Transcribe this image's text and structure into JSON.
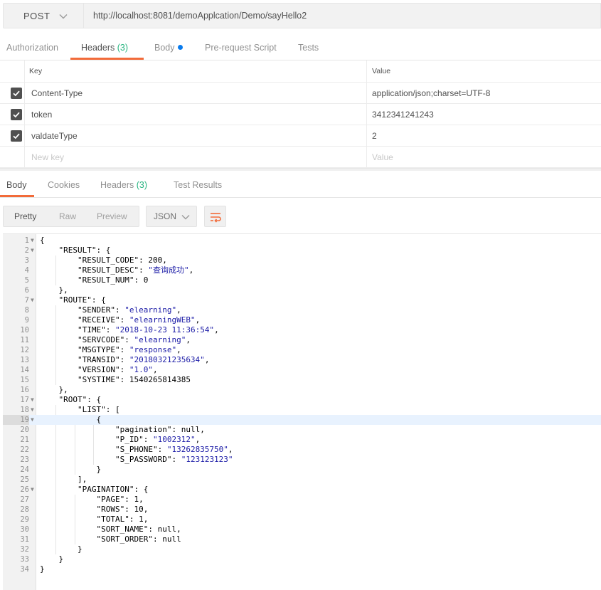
{
  "request": {
    "method": "POST",
    "url": "http://localhost:8081/demoApplcation/Demo/sayHello2"
  },
  "request_tabs": [
    {
      "label": "Authorization",
      "count": "",
      "dot": false,
      "active": false
    },
    {
      "label": "Headers",
      "count": "(3)",
      "dot": false,
      "active": true
    },
    {
      "label": "Body",
      "count": "",
      "dot": true,
      "active": false
    },
    {
      "label": "Pre-request Script",
      "count": "",
      "dot": false,
      "active": false
    },
    {
      "label": "Tests",
      "count": "",
      "dot": false,
      "active": false
    }
  ],
  "headers_table": {
    "key_header": "Key",
    "value_header": "Value",
    "rows": [
      {
        "key": "Content-Type",
        "value": "application/json;charset=UTF-8",
        "checked": true
      },
      {
        "key": "token",
        "value": "3412341241243",
        "checked": true
      },
      {
        "key": "valdateType",
        "value": "2",
        "checked": true
      }
    ],
    "new_key_placeholder": "New key",
    "new_value_placeholder": "Value"
  },
  "response_tabs": [
    {
      "label": "Body",
      "count": "",
      "active": true
    },
    {
      "label": "Cookies",
      "count": "",
      "active": false
    },
    {
      "label": "Headers",
      "count": "(3)",
      "active": false
    },
    {
      "label": "Test Results",
      "count": "",
      "active": false
    }
  ],
  "view_modes": {
    "pretty": "Pretty",
    "raw": "Raw",
    "preview": "Preview"
  },
  "format": "JSON",
  "code_lines": [
    "{",
    "    \"RESULT\": {",
    "        \"RESULT_CODE\": 200,",
    "        \"RESULT_DESC\": \"查询成功\",",
    "        \"RESULT_NUM\": 0",
    "    },",
    "    \"ROUTE\": {",
    "        \"SENDER\": \"elearning\",",
    "        \"RECEIVE\": \"elearningWEB\",",
    "        \"TIME\": \"2018-10-23 11:36:54\",",
    "        \"SERVCODE\": \"elearning\",",
    "        \"MSGTYPE\": \"response\",",
    "        \"TRANSID\": \"20180321235634\",",
    "        \"VERSION\": \"1.0\",",
    "        \"SYSTIME\": 1540265814385",
    "    },",
    "    \"ROOT\": {",
    "        \"LIST\": [",
    "            {",
    "                \"pagination\": null,",
    "                \"P_ID\": \"1002312\",",
    "                \"S_PHONE\": \"13262835750\",",
    "                \"S_PASSWORD\": \"123123123\"",
    "            }",
    "        ],",
    "        \"PAGINATION\": {",
    "            \"PAGE\": 1,",
    "            \"ROWS\": 10,",
    "            \"TOTAL\": 1,",
    "            \"SORT_NAME\": null,",
    "            \"SORT_ORDER\": null",
    "        }",
    "    }",
    "}"
  ],
  "fold_lines": [
    1,
    2,
    7,
    17,
    18,
    19,
    26
  ],
  "active_line": 19,
  "colors": {
    "accent": "#f26b3a",
    "count_green": "#26b47f",
    "dot_blue": "#097bed",
    "string_blue": "#1a1aa6"
  },
  "icons": {
    "method_dropdown": "chevron-down-icon",
    "format_dropdown": "chevron-down-icon",
    "wrap": "wrap-lines-icon",
    "check": "checkmark-icon"
  }
}
